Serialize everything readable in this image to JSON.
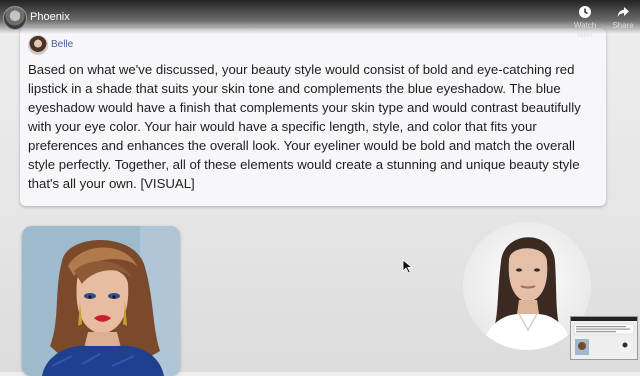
{
  "video_header": {
    "channel_title": "Phoenix",
    "actions": [
      {
        "label": "Watch later",
        "icon": "clock-icon"
      },
      {
        "label": "Share",
        "icon": "share-arrow-icon"
      }
    ]
  },
  "message": {
    "sender_name": "Belle",
    "text": "Based on what we've discussed, your beauty style would consist of bold and eye-catching red lipstick in a shade that suits your skin tone and complements the blue eyeshadow. The blue eyeshadow would have a finish that complements your skin type and would contrast beautifully with your eye color. Your hair would have a specific length, style, and color that fits your preferences and enhances the overall look. Your eyeliner would be bold and match the overall style perfectly. Together, all of these elements would create a stunning and unique beauty style that's all your own. [VISUAL]"
  },
  "colors": {
    "sender_name": "#4a5d8f",
    "card_background": "#f7f7fb",
    "lipstick": "#c9202c",
    "dress": "#1f3f8f"
  }
}
